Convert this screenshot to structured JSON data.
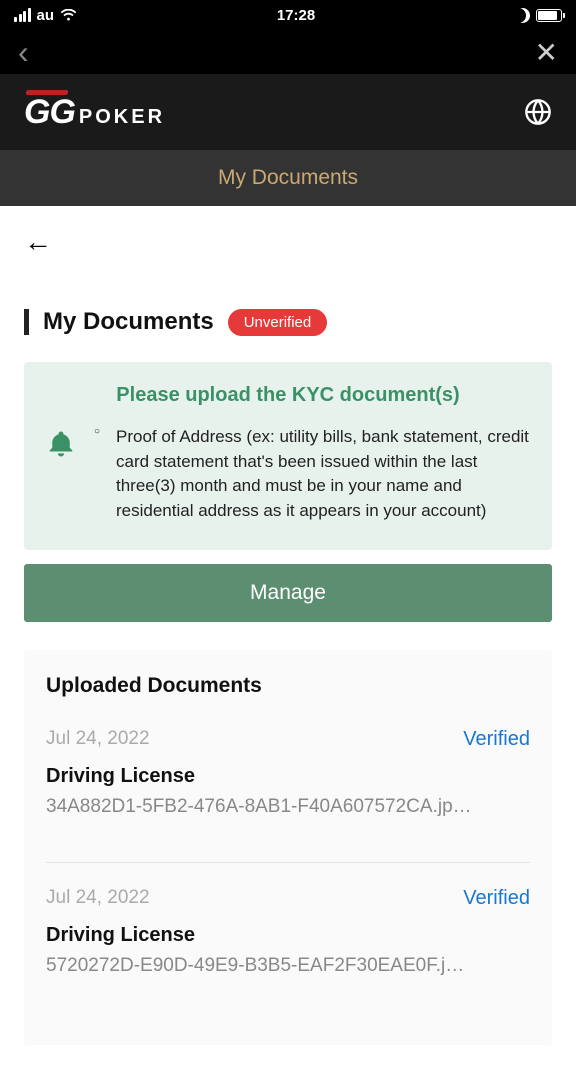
{
  "status": {
    "carrier": "au",
    "time": "17:28"
  },
  "logo": {
    "gg": "GG",
    "poker": "POKER"
  },
  "titleBar": "My Documents",
  "section": {
    "title": "My Documents",
    "badge": "Unverified"
  },
  "notice": {
    "title": "Please upload the KYC document(s)",
    "item": "Proof of Address (ex: utility bills, bank statement, credit card statement that's been issued within the last three(3) month and must be in your name and residential address as it appears in your account)"
  },
  "manageLabel": "Manage",
  "uploaded": {
    "heading": "Uploaded Documents",
    "docs": [
      {
        "date": "Jul 24, 2022",
        "status": "Verified",
        "type": "Driving License",
        "file": "34A882D1-5FB2-476A-8AB1-F40A607572CA.jp…"
      },
      {
        "date": "Jul 24, 2022",
        "status": "Verified",
        "type": "Driving License",
        "file": "5720272D-E90D-49E9-B3B5-EAF2F30EAE0F.j…"
      }
    ]
  }
}
